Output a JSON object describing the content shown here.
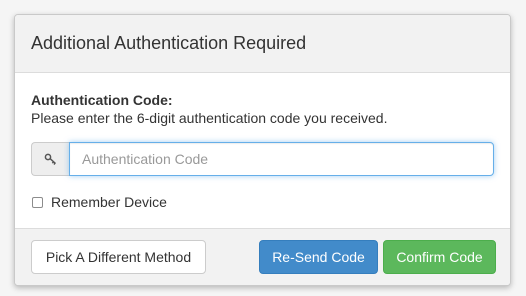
{
  "modal": {
    "title": "Additional Authentication Required"
  },
  "form": {
    "code_label": "Authentication Code:",
    "instructions": "Please enter the 6-digit authentication code you received.",
    "input_placeholder": "Authentication Code",
    "input_value": "",
    "input_icon": "key-icon",
    "remember_label": "Remember Device",
    "remember_checked": false
  },
  "footer": {
    "different_method_label": "Pick A Different Method",
    "resend_label": "Re-Send Code",
    "confirm_label": "Confirm Code"
  },
  "colors": {
    "primary": "#428bca",
    "success": "#5cb85c",
    "focus": "#66afe9"
  }
}
